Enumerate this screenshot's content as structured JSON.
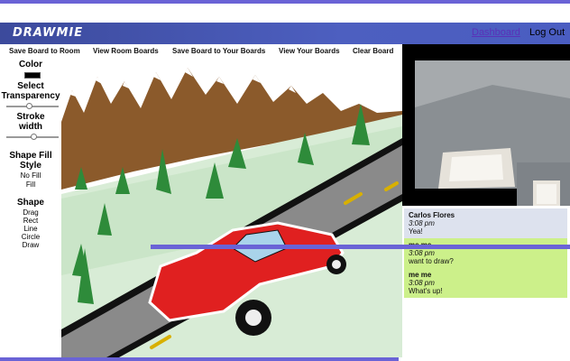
{
  "header": {
    "brand": "DRAWMIE",
    "dashboard_link": "Dashboard",
    "logout_link": "Log Out"
  },
  "toolbar": {
    "save_room": "Save Board to Room",
    "view_room": "View Room Boards",
    "save_yours": "Save Board to Your Boards",
    "view_yours": "View Your Boards",
    "clear": "Clear Board"
  },
  "sidebar": {
    "color_label": "Color",
    "color_value": "#000000",
    "transparency_label_1": "Select",
    "transparency_label_2": "Transparency",
    "stroke_label_1": "Stroke",
    "stroke_label_2": "width",
    "fill_label_1": "Shape Fill",
    "fill_label_2": "Style",
    "fill_options": [
      "No Fill",
      "Fill"
    ],
    "shape_label": "Shape",
    "shape_options": [
      "Drag",
      "Rect",
      "Line",
      "Circle",
      "Draw"
    ]
  },
  "chat": {
    "messages": [
      {
        "author": "Carlos Flores",
        "time": "3:08 pm",
        "text": "Yea!",
        "style": "other"
      },
      {
        "author": "me me",
        "time": "3:08 pm",
        "text": "want to draw?",
        "style": "self"
      },
      {
        "author": "me me",
        "time": "3:08 pm",
        "text": "What's up!",
        "style": "self"
      }
    ]
  },
  "colors": {
    "nav": "#4a5dc1",
    "accent": "#6a63d6",
    "chat_other": "#dde2ee",
    "chat_self": "#ccf08a",
    "car": "#e02020",
    "mountains": "#8b5a2b",
    "trees": "#2e8b3a",
    "road": "#8a8a8a"
  }
}
